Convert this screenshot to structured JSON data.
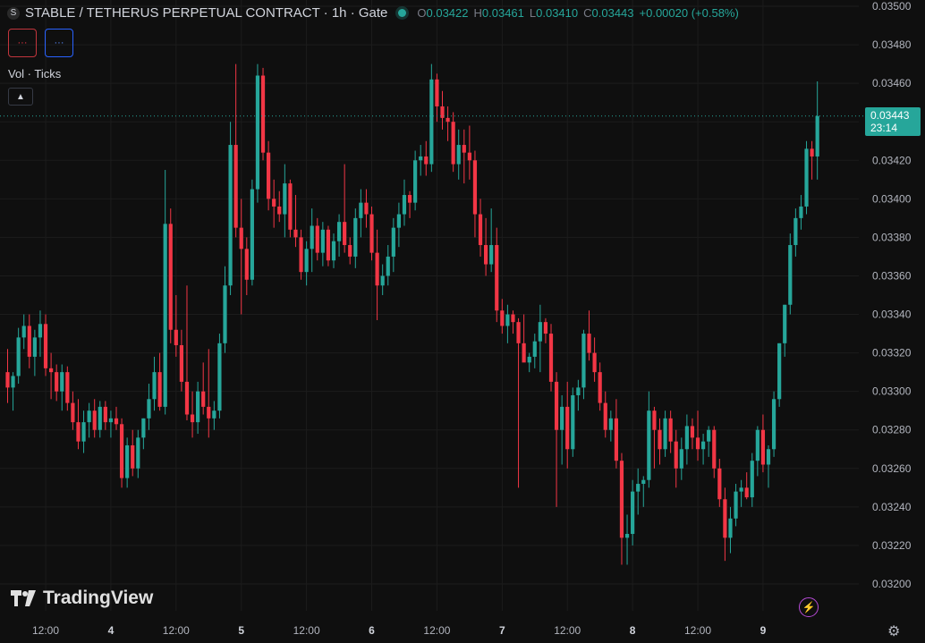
{
  "header": {
    "symbol_icon": "tether-coin-icon",
    "title": "STABLE / TETHERUS PERPETUAL CONTRACT · 1h · Gate",
    "open_label": "O",
    "open": "0.03422",
    "high_label": "H",
    "high": "0.03461",
    "low_label": "L",
    "low": "0.03410",
    "close_label": "C",
    "close": "0.03443",
    "change": "+0.00020 (+0.58%)"
  },
  "buttons": {
    "sell": "···",
    "buy": "···"
  },
  "volume_label": "Vol · Ticks",
  "collapse_icon": "chevron-up-icon",
  "brand": "TradingView",
  "price_tag": {
    "price": "0.03443",
    "countdown": "23:14"
  },
  "colors": {
    "up": "#26a69a",
    "down": "#f23645",
    "background": "#0f0f0f",
    "grid": "#1c1c1c"
  },
  "chart_data": {
    "type": "candlestick",
    "y_ticks": [
      "0.03500",
      "0.03480",
      "0.03460",
      "0.03440",
      "0.03420",
      "0.03400",
      "0.03380",
      "0.03360",
      "0.03340",
      "0.03320",
      "0.03300",
      "0.03280",
      "0.03260",
      "0.03240",
      "0.03220",
      "0.03200"
    ],
    "ylim": [
      0.03193,
      0.03503
    ],
    "x_ticks": [
      {
        "index": 7,
        "label": "12:00"
      },
      {
        "index": 19,
        "label": "4"
      },
      {
        "index": 31,
        "label": "12:00"
      },
      {
        "index": 43,
        "label": "5"
      },
      {
        "index": 55,
        "label": "12:00"
      },
      {
        "index": 67,
        "label": "6"
      },
      {
        "index": 79,
        "label": "12:00"
      },
      {
        "index": 91,
        "label": "7"
      },
      {
        "index": 103,
        "label": "12:00"
      },
      {
        "index": 115,
        "label": "8"
      },
      {
        "index": 127,
        "label": "12:00"
      },
      {
        "index": 139,
        "label": "9"
      }
    ],
    "last_price": 0.03443,
    "candles": [
      [
        0.0331,
        0.03322,
        0.03294,
        0.03302
      ],
      [
        0.03302,
        0.0331,
        0.0329,
        0.03308
      ],
      [
        0.03308,
        0.03333,
        0.03304,
        0.03328
      ],
      [
        0.03328,
        0.0334,
        0.03322,
        0.03334
      ],
      [
        0.03334,
        0.0334,
        0.03312,
        0.03318
      ],
      [
        0.03318,
        0.03332,
        0.03308,
        0.03328
      ],
      [
        0.03328,
        0.03342,
        0.03318,
        0.03335
      ],
      [
        0.03335,
        0.0334,
        0.03308,
        0.03312
      ],
      [
        0.03312,
        0.0332,
        0.03296,
        0.0331
      ],
      [
        0.0331,
        0.03314,
        0.03295,
        0.033
      ],
      [
        0.033,
        0.03314,
        0.0329,
        0.0331
      ],
      [
        0.0331,
        0.03313,
        0.0329,
        0.03294
      ],
      [
        0.03294,
        0.033,
        0.0328,
        0.03284
      ],
      [
        0.03284,
        0.03296,
        0.0327,
        0.03274
      ],
      [
        0.03274,
        0.0329,
        0.03268,
        0.03284
      ],
      [
        0.03284,
        0.03294,
        0.03276,
        0.0329
      ],
      [
        0.0329,
        0.03296,
        0.03276,
        0.0328
      ],
      [
        0.0328,
        0.03295,
        0.03276,
        0.03292
      ],
      [
        0.03292,
        0.03295,
        0.0328,
        0.03284
      ],
      [
        0.03284,
        0.0329,
        0.03276,
        0.03286
      ],
      [
        0.03286,
        0.03292,
        0.0328,
        0.03283
      ],
      [
        0.03283,
        0.03286,
        0.0325,
        0.03255
      ],
      [
        0.03255,
        0.03276,
        0.0325,
        0.03272
      ],
      [
        0.03272,
        0.0328,
        0.03256,
        0.0326
      ],
      [
        0.0326,
        0.0328,
        0.03255,
        0.03276
      ],
      [
        0.03276,
        0.03286,
        0.0327,
        0.03286
      ],
      [
        0.03286,
        0.03304,
        0.0328,
        0.03296
      ],
      [
        0.03296,
        0.03318,
        0.0329,
        0.0331
      ],
      [
        0.0331,
        0.0332,
        0.0329,
        0.03292
      ],
      [
        0.03292,
        0.03415,
        0.03288,
        0.03387
      ],
      [
        0.03387,
        0.03395,
        0.03325,
        0.03332
      ],
      [
        0.03332,
        0.0335,
        0.03318,
        0.03324
      ],
      [
        0.03324,
        0.03332,
        0.033,
        0.03305
      ],
      [
        0.03305,
        0.03355,
        0.03285,
        0.03288
      ],
      [
        0.03288,
        0.033,
        0.03276,
        0.03284
      ],
      [
        0.03284,
        0.03305,
        0.03278,
        0.033
      ],
      [
        0.033,
        0.03315,
        0.03288,
        0.03292
      ],
      [
        0.03292,
        0.03322,
        0.03276,
        0.03286
      ],
      [
        0.03286,
        0.03295,
        0.0328,
        0.0329
      ],
      [
        0.0329,
        0.0333,
        0.03286,
        0.03325
      ],
      [
        0.03325,
        0.03365,
        0.0332,
        0.03355
      ],
      [
        0.03355,
        0.0344,
        0.0335,
        0.03428
      ],
      [
        0.03428,
        0.0347,
        0.0338,
        0.03385
      ],
      [
        0.03385,
        0.034,
        0.0334,
        0.03374
      ],
      [
        0.03374,
        0.0338,
        0.0335,
        0.03358
      ],
      [
        0.03358,
        0.0341,
        0.03355,
        0.03405
      ],
      [
        0.03405,
        0.0347,
        0.03398,
        0.03464
      ],
      [
        0.03464,
        0.03468,
        0.0342,
        0.03424
      ],
      [
        0.03424,
        0.0343,
        0.03394,
        0.034
      ],
      [
        0.034,
        0.0341,
        0.03385,
        0.03396
      ],
      [
        0.03396,
        0.03404,
        0.03388,
        0.03392
      ],
      [
        0.03392,
        0.03418,
        0.0338,
        0.03408
      ],
      [
        0.03408,
        0.0341,
        0.0338,
        0.03384
      ],
      [
        0.03384,
        0.03402,
        0.03375,
        0.0338
      ],
      [
        0.0338,
        0.03384,
        0.03358,
        0.03362
      ],
      [
        0.03362,
        0.03378,
        0.03355,
        0.03374
      ],
      [
        0.03374,
        0.03395,
        0.03362,
        0.03386
      ],
      [
        0.03386,
        0.0339,
        0.03368,
        0.03372
      ],
      [
        0.03372,
        0.03388,
        0.03365,
        0.03384
      ],
      [
        0.03384,
        0.03386,
        0.03365,
        0.03368
      ],
      [
        0.03368,
        0.03382,
        0.03364,
        0.03378
      ],
      [
        0.03378,
        0.03392,
        0.0337,
        0.03388
      ],
      [
        0.03388,
        0.03418,
        0.03372,
        0.03376
      ],
      [
        0.03376,
        0.0338,
        0.03366,
        0.0337
      ],
      [
        0.0337,
        0.03395,
        0.03364,
        0.0339
      ],
      [
        0.0339,
        0.03405,
        0.0338,
        0.03398
      ],
      [
        0.03398,
        0.03405,
        0.03385,
        0.03392
      ],
      [
        0.03392,
        0.03396,
        0.03368,
        0.03372
      ],
      [
        0.03372,
        0.03384,
        0.03337,
        0.03355
      ],
      [
        0.03355,
        0.03366,
        0.0335,
        0.0336
      ],
      [
        0.0336,
        0.03376,
        0.03355,
        0.0337
      ],
      [
        0.0337,
        0.0339,
        0.03362,
        0.03385
      ],
      [
        0.03385,
        0.03398,
        0.03375,
        0.03392
      ],
      [
        0.03392,
        0.0341,
        0.03386,
        0.03402
      ],
      [
        0.03402,
        0.03404,
        0.0339,
        0.03398
      ],
      [
        0.03398,
        0.03425,
        0.03394,
        0.0342
      ],
      [
        0.0342,
        0.03428,
        0.03412,
        0.03422
      ],
      [
        0.03422,
        0.0343,
        0.03412,
        0.03418
      ],
      [
        0.03418,
        0.0347,
        0.03414,
        0.03462
      ],
      [
        0.03462,
        0.03465,
        0.0344,
        0.03448
      ],
      [
        0.03448,
        0.03456,
        0.03436,
        0.03442
      ],
      [
        0.03442,
        0.03448,
        0.0343,
        0.0344
      ],
      [
        0.0344,
        0.03445,
        0.03414,
        0.03418
      ],
      [
        0.03418,
        0.03436,
        0.0341,
        0.03428
      ],
      [
        0.03428,
        0.03436,
        0.03408,
        0.03424
      ],
      [
        0.03424,
        0.03438,
        0.0341,
        0.0342
      ],
      [
        0.0342,
        0.03425,
        0.0338,
        0.03392
      ],
      [
        0.03392,
        0.034,
        0.0337,
        0.03376
      ],
      [
        0.03376,
        0.0339,
        0.0336,
        0.03366
      ],
      [
        0.03366,
        0.03395,
        0.03362,
        0.03376
      ],
      [
        0.03376,
        0.03385,
        0.03336,
        0.03342
      ],
      [
        0.03342,
        0.03348,
        0.0333,
        0.03334
      ],
      [
        0.03334,
        0.03345,
        0.03325,
        0.0334
      ],
      [
        0.0334,
        0.03342,
        0.0333,
        0.03336
      ],
      [
        0.03336,
        0.03338,
        0.0325,
        0.03325
      ],
      [
        0.03325,
        0.0334,
        0.03318,
        0.03315
      ],
      [
        0.03315,
        0.0332,
        0.0331,
        0.03318
      ],
      [
        0.03318,
        0.0333,
        0.03312,
        0.03326
      ],
      [
        0.03326,
        0.03345,
        0.0331,
        0.03336
      ],
      [
        0.03336,
        0.03338,
        0.03325,
        0.0333
      ],
      [
        0.0333,
        0.03335,
        0.033,
        0.03305
      ],
      [
        0.03305,
        0.0331,
        0.0324,
        0.0328
      ],
      [
        0.0328,
        0.03298,
        0.03262,
        0.03292
      ],
      [
        0.03292,
        0.03305,
        0.0326,
        0.0327
      ],
      [
        0.0327,
        0.03302,
        0.03266,
        0.03298
      ],
      [
        0.03298,
        0.03306,
        0.0329,
        0.03302
      ],
      [
        0.03302,
        0.03332,
        0.03296,
        0.0333
      ],
      [
        0.0333,
        0.03342,
        0.03316,
        0.0332
      ],
      [
        0.0332,
        0.03328,
        0.03305,
        0.0331
      ],
      [
        0.0331,
        0.03315,
        0.0329,
        0.03294
      ],
      [
        0.03294,
        0.033,
        0.03276,
        0.0328
      ],
      [
        0.0328,
        0.0329,
        0.03274,
        0.03286
      ],
      [
        0.03286,
        0.03296,
        0.0326,
        0.03264
      ],
      [
        0.03264,
        0.03268,
        0.0321,
        0.03224
      ],
      [
        0.03224,
        0.03236,
        0.0321,
        0.03226
      ],
      [
        0.03226,
        0.03254,
        0.0322,
        0.03248
      ],
      [
        0.03248,
        0.0326,
        0.03236,
        0.03252
      ],
      [
        0.03252,
        0.03256,
        0.0324,
        0.03254
      ],
      [
        0.03254,
        0.033,
        0.0325,
        0.0329
      ],
      [
        0.0329,
        0.03292,
        0.0326,
        0.0328
      ],
      [
        0.0328,
        0.03286,
        0.03262,
        0.0327
      ],
      [
        0.0327,
        0.0329,
        0.03266,
        0.03286
      ],
      [
        0.03286,
        0.0329,
        0.03268,
        0.03274
      ],
      [
        0.03274,
        0.0328,
        0.0325,
        0.0326
      ],
      [
        0.0326,
        0.03276,
        0.03254,
        0.0327
      ],
      [
        0.0327,
        0.03288,
        0.03262,
        0.03282
      ],
      [
        0.03282,
        0.03286,
        0.0327,
        0.03276
      ],
      [
        0.03276,
        0.0329,
        0.03264,
        0.0327
      ],
      [
        0.0327,
        0.03278,
        0.03262,
        0.03274
      ],
      [
        0.03274,
        0.03282,
        0.03266,
        0.0328
      ],
      [
        0.0328,
        0.03282,
        0.03255,
        0.0326
      ],
      [
        0.0326,
        0.03265,
        0.0324,
        0.03244
      ],
      [
        0.03244,
        0.0325,
        0.03212,
        0.03224
      ],
      [
        0.03224,
        0.0324,
        0.03216,
        0.03234
      ],
      [
        0.03234,
        0.03252,
        0.0323,
        0.03248
      ],
      [
        0.03248,
        0.03254,
        0.0324,
        0.0325
      ],
      [
        0.0325,
        0.03258,
        0.03244,
        0.03245
      ],
      [
        0.03245,
        0.03268,
        0.0324,
        0.03264
      ],
      [
        0.03264,
        0.03282,
        0.03256,
        0.0328
      ],
      [
        0.0328,
        0.03288,
        0.03258,
        0.03262
      ],
      [
        0.03262,
        0.03272,
        0.0325,
        0.0327
      ],
      [
        0.0327,
        0.033,
        0.03266,
        0.03296
      ],
      [
        0.03296,
        0.03325,
        0.03292,
        0.03325
      ],
      [
        0.03325,
        0.03345,
        0.03318,
        0.03345
      ],
      [
        0.03345,
        0.03382,
        0.0334,
        0.03376
      ],
      [
        0.03376,
        0.03395,
        0.0337,
        0.0339
      ],
      [
        0.0339,
        0.03402,
        0.03384,
        0.03396
      ],
      [
        0.03396,
        0.0343,
        0.03392,
        0.03426
      ],
      [
        0.03426,
        0.0343,
        0.0341,
        0.03422
      ],
      [
        0.03422,
        0.03461,
        0.0341,
        0.03443
      ]
    ]
  }
}
